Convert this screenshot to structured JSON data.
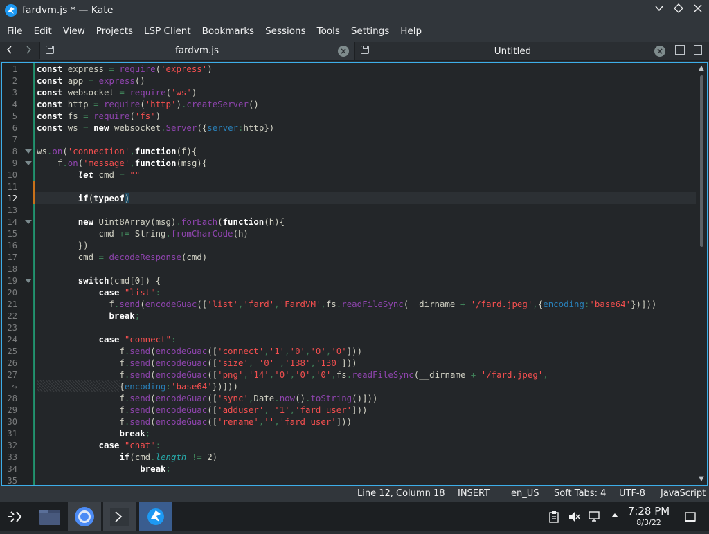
{
  "window": {
    "title": "fardvm.js * — Kate",
    "controls": [
      "chevron-down-icon",
      "diamond-icon",
      "close-icon"
    ]
  },
  "menu": [
    "File",
    "Edit",
    "View",
    "Projects",
    "LSP Client",
    "Bookmarks",
    "Sessions",
    "Tools",
    "Settings",
    "Help"
  ],
  "tabs": [
    {
      "label": "fardvm.js",
      "active": true
    },
    {
      "label": "Untitled",
      "active": false
    }
  ],
  "editor": {
    "current_line": "12",
    "line_numbers": [
      "1",
      "2",
      "3",
      "4",
      "5",
      "6",
      "7",
      "8",
      "9",
      "10",
      "11",
      "12",
      "13",
      "14",
      "15",
      "16",
      "17",
      "18",
      "19",
      "20",
      "21",
      "22",
      "23",
      "24",
      "25",
      "26",
      "27",
      "↪",
      "28",
      "29",
      "30",
      "31",
      "32",
      "33",
      "34",
      "35"
    ],
    "fold_lines": [
      "8",
      "9",
      "14",
      "19"
    ],
    "modified_lines": [
      "11",
      "12"
    ],
    "code_lines": [
      "const express = require('express')",
      "const app = express()",
      "const websocket = require('ws')",
      "const http = require('http').createServer()",
      "const fs = require('fs')",
      "const ws = new websocket.Server({server:http})",
      "",
      "ws.on('connection',function(f){",
      "    f.on('message',function(msg){",
      "        let cmd = \"\"",
      "",
      "        if(typeof)",
      "",
      "        new Uint8Array(msg).forEach(function(h){",
      "            cmd += String.fromCharCode(h)",
      "        })",
      "        cmd = decodeResponse(cmd)",
      "",
      "        switch(cmd[0]) {",
      "            case \"list\":",
      "              f.send(encodeGuac(['list','fard','FardVM',fs.readFileSync(__dirname + '/fard.jpeg',{encoding:'base64'})]))",
      "              break;",
      "",
      "            case \"connect\":",
      "                f.send(encodeGuac(['connect','1','0','0','0']))",
      "                f.send(encodeGuac(['size', '0' ,'138','130']))",
      "                f.send(encodeGuac(['png','14','0','0','0',fs.readFileSync(__dirname + '/fard.jpeg',",
      "                {encoding:'base64'})]))",
      "                f.send(encodeGuac(['sync',Date.now().toString()]))",
      "                f.send(encodeGuac(['adduser', '1','fard user']))",
      "                f.send(encodeGuac(['rename','','fard user']))",
      "                break;",
      "            case \"chat\":",
      "                if(cmd.length != 2)",
      "                    break;",
      ""
    ]
  },
  "status": {
    "position": "Line 12, Column 18",
    "mode": "INSERT",
    "dictionary": "en_US",
    "indent": "Soft Tabs: 4",
    "encoding": "UTF-8",
    "language": "JavaScript"
  },
  "taskbar": {
    "launchers": [
      "application-launcher-icon",
      "file-manager-icon",
      "chromium-browser-icon",
      "terminal-icon",
      "kate-editor-icon"
    ],
    "tray": [
      "clipboard-icon",
      "volume-muted-icon",
      "network-icon",
      "tray-expand-icon"
    ],
    "time": "7:28 PM",
    "date": "8/3/22"
  },
  "colors": {
    "accent": "#3daee9",
    "editor_bg": "#232629",
    "string": "#f44f4f",
    "function": "#8e44ad",
    "operator": "#3f8058",
    "property": "#2980b9"
  }
}
